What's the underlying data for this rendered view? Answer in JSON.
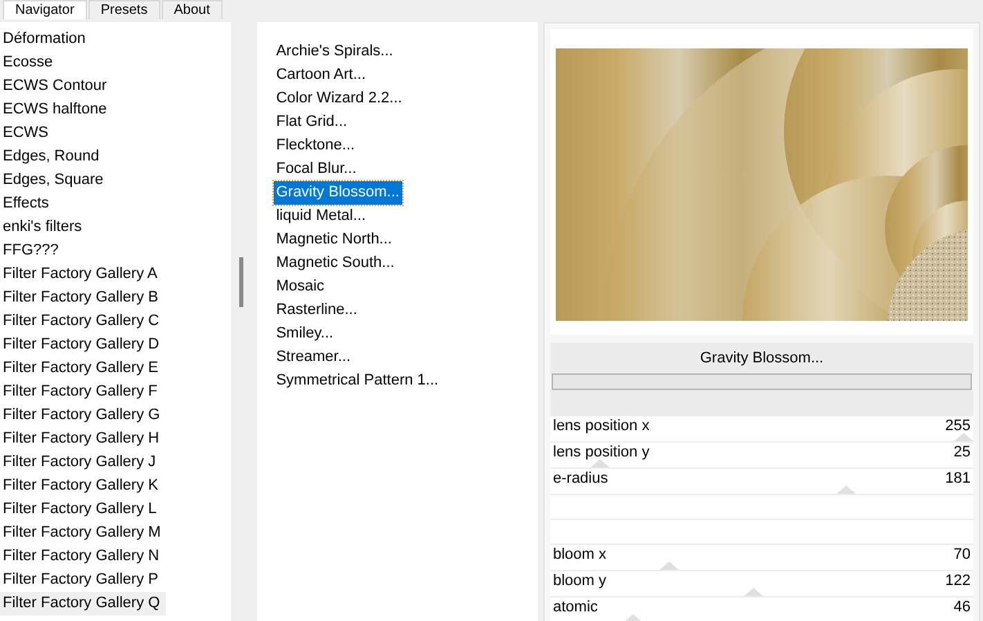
{
  "tabs": [
    {
      "label": "Navigator",
      "selected": true
    },
    {
      "label": "Presets",
      "selected": false
    },
    {
      "label": "About",
      "selected": false
    }
  ],
  "categories": [
    {
      "label": "Déformation",
      "selected": false
    },
    {
      "label": "Ecosse",
      "selected": false
    },
    {
      "label": "ECWS Contour",
      "selected": false
    },
    {
      "label": "ECWS halftone",
      "selected": false
    },
    {
      "label": "ECWS",
      "selected": false
    },
    {
      "label": "Edges, Round",
      "selected": false
    },
    {
      "label": "Edges, Square",
      "selected": false
    },
    {
      "label": "Effects",
      "selected": false
    },
    {
      "label": "enki's filters",
      "selected": false
    },
    {
      "label": "FFG???",
      "selected": false
    },
    {
      "label": "Filter Factory Gallery A",
      "selected": false
    },
    {
      "label": "Filter Factory Gallery B",
      "selected": false
    },
    {
      "label": "Filter Factory Gallery C",
      "selected": false
    },
    {
      "label": "Filter Factory Gallery D",
      "selected": false
    },
    {
      "label": "Filter Factory Gallery E",
      "selected": false
    },
    {
      "label": "Filter Factory Gallery F",
      "selected": false
    },
    {
      "label": "Filter Factory Gallery G",
      "selected": false
    },
    {
      "label": "Filter Factory Gallery H",
      "selected": false
    },
    {
      "label": "Filter Factory Gallery J",
      "selected": false
    },
    {
      "label": "Filter Factory Gallery K",
      "selected": false
    },
    {
      "label": "Filter Factory Gallery L",
      "selected": false
    },
    {
      "label": "Filter Factory Gallery M",
      "selected": false
    },
    {
      "label": "Filter Factory Gallery N",
      "selected": false
    },
    {
      "label": "Filter Factory Gallery P",
      "selected": false
    },
    {
      "label": "Filter Factory Gallery Q",
      "selected": true
    }
  ],
  "filters": [
    {
      "label": "Archie's Spirals...",
      "selected": false
    },
    {
      "label": "Cartoon Art...",
      "selected": false
    },
    {
      "label": "Color Wizard 2.2...",
      "selected": false
    },
    {
      "label": "Flat Grid...",
      "selected": false
    },
    {
      "label": "Flecktone...",
      "selected": false
    },
    {
      "label": "Focal Blur...",
      "selected": false
    },
    {
      "label": "Gravity Blossom...",
      "selected": true
    },
    {
      "label": "liquid Metal...",
      "selected": false
    },
    {
      "label": "Magnetic North...",
      "selected": false
    },
    {
      "label": "Magnetic South...",
      "selected": false
    },
    {
      "label": "Mosaic",
      "selected": false
    },
    {
      "label": "Rasterline...",
      "selected": false
    },
    {
      "label": "Smiley...",
      "selected": false
    },
    {
      "label": "Streamer...",
      "selected": false
    },
    {
      "label": "Symmetrical Pattern 1...",
      "selected": false
    }
  ],
  "filter_button": "Gravity Blossom...",
  "parameters": [
    {
      "kind": "slider",
      "name": "lens position x",
      "value": "255",
      "level": 1
    },
    {
      "kind": "slider",
      "name": "lens position y",
      "value": "25",
      "level": 0.1
    },
    {
      "kind": "slider",
      "name": "e-radius",
      "value": "181",
      "level": 0.71
    },
    {
      "kind": "empty"
    },
    {
      "kind": "empty"
    },
    {
      "kind": "slider",
      "name": "bloom x",
      "value": "70",
      "level": 0.27
    },
    {
      "kind": "slider",
      "name": "bloom y",
      "value": "122",
      "level": 0.48
    },
    {
      "kind": "slider",
      "name": "atomic",
      "value": "46",
      "level": 0.18
    }
  ]
}
